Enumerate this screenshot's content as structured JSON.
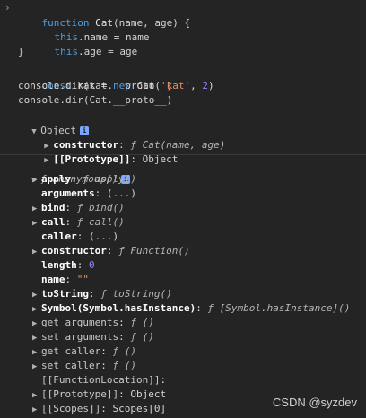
{
  "code": {
    "line1": {
      "kw": "function",
      "name": "Cat",
      "params": "(name, age) {"
    },
    "line2": {
      "this": "this",
      "rest": ".name = name"
    },
    "line3": {
      "this": "this",
      "rest": ".age = age"
    },
    "line4": "}",
    "line5": {
      "kw": "const",
      "a": "kat = ",
      "new": "new",
      "cls": "Cat(",
      "str": "'kat'",
      "sep": ", ",
      "num": "2",
      "end": ")"
    },
    "line6": "console.dir(kat.__proto__)",
    "line7": "console.dir(Cat.__proto__)"
  },
  "obj1": {
    "title": "Object",
    "rows": [
      {
        "key": "constructor",
        "colon": ":",
        "f": "ƒ",
        "val": "Cat(name, age)"
      },
      {
        "key": "[[Prototype]]",
        "colon": ":",
        "val": "Object"
      }
    ]
  },
  "obj2": {
    "title": "anonymous()",
    "f": "ƒ",
    "rows": [
      {
        "key": "apply",
        "val": "apply()"
      },
      {
        "key": "arguments",
        "val": "(...)"
      },
      {
        "key": "bind",
        "val": "bind()"
      },
      {
        "key": "call",
        "val": "call()"
      },
      {
        "key": "caller",
        "val": "(...)"
      },
      {
        "key": "constructor",
        "val": "Function()"
      },
      {
        "key": "length",
        "val": "0"
      },
      {
        "key": "name",
        "val": "\"\""
      },
      {
        "key": "toString",
        "val": "toString()"
      },
      {
        "key": "Symbol(Symbol.hasInstance)",
        "val": "[Symbol.hasInstance]()"
      },
      {
        "key": "get arguments",
        "val": "()"
      },
      {
        "key": "set arguments",
        "val": "()"
      },
      {
        "key": "get caller",
        "val": "()"
      },
      {
        "key": "set caller",
        "val": "()"
      },
      {
        "key": "[[FunctionLocation]]",
        "val": ""
      },
      {
        "key": "[[Prototype]]",
        "val": "Object"
      },
      {
        "key": "[[Scopes]]",
        "val": "Scopes[0]"
      }
    ]
  },
  "watermark": "CSDN @syzdev"
}
